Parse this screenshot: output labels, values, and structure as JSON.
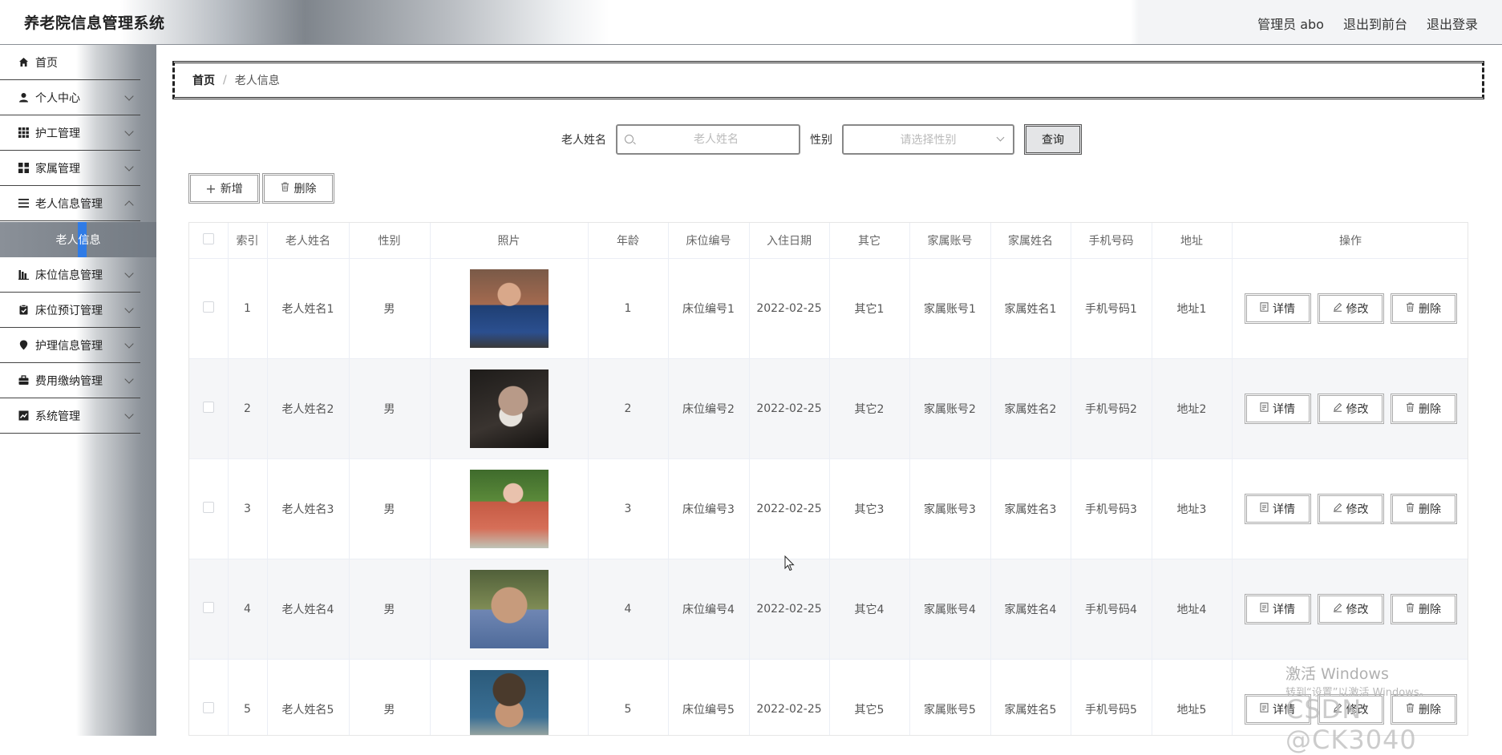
{
  "header": {
    "app_title": "养老院信息管理系统",
    "admin_label": "管理员 abo",
    "to_front_label": "退出到前台",
    "logout_label": "退出登录"
  },
  "sidebar": {
    "items": [
      {
        "label": "首页",
        "icon": "home-icon"
      },
      {
        "label": "个人中心",
        "icon": "user-icon"
      },
      {
        "label": "护工管理",
        "icon": "grid-icon"
      },
      {
        "label": "家属管理",
        "icon": "apps-icon"
      },
      {
        "label": "老人信息管理",
        "icon": "list-icon"
      },
      {
        "label": "床位信息管理",
        "icon": "bed-chart-icon"
      },
      {
        "label": "床位预订管理",
        "icon": "clipboard-icon"
      },
      {
        "label": "护理信息管理",
        "icon": "location-icon"
      },
      {
        "label": "费用缴纳管理",
        "icon": "briefcase-icon"
      },
      {
        "label": "系统管理",
        "icon": "trend-icon"
      }
    ],
    "active_sub": "老人信息"
  },
  "breadcrumb": {
    "home": "首页",
    "separator": "/",
    "current": "老人信息"
  },
  "search": {
    "name_label": "老人姓名",
    "name_placeholder": "老人姓名",
    "gender_label": "性别",
    "gender_placeholder": "请选择性别",
    "query_label": "查询"
  },
  "actions": {
    "add_label": "新增",
    "delete_label": "删除"
  },
  "table": {
    "columns": [
      "索引",
      "老人姓名",
      "性别",
      "照片",
      "年龄",
      "床位编号",
      "入住日期",
      "其它",
      "家属账号",
      "家属姓名",
      "手机号码",
      "地址",
      "操作"
    ],
    "rows": [
      {
        "index": "1",
        "name": "老人姓名1",
        "gender": "男",
        "age": "1",
        "bed": "床位编号1",
        "date": "2022-02-25",
        "other": "其它1",
        "family_account": "家属账号1",
        "family_name": "家属姓名1",
        "phone": "手机号码1",
        "address": "地址1"
      },
      {
        "index": "2",
        "name": "老人姓名2",
        "gender": "男",
        "age": "2",
        "bed": "床位编号2",
        "date": "2022-02-25",
        "other": "其它2",
        "family_account": "家属账号2",
        "family_name": "家属姓名2",
        "phone": "手机号码2",
        "address": "地址2"
      },
      {
        "index": "3",
        "name": "老人姓名3",
        "gender": "男",
        "age": "3",
        "bed": "床位编号3",
        "date": "2022-02-25",
        "other": "其它3",
        "family_account": "家属账号3",
        "family_name": "家属姓名3",
        "phone": "手机号码3",
        "address": "地址3"
      },
      {
        "index": "4",
        "name": "老人姓名4",
        "gender": "男",
        "age": "4",
        "bed": "床位编号4",
        "date": "2022-02-25",
        "other": "其它4",
        "family_account": "家属账号4",
        "family_name": "家属姓名4",
        "phone": "手机号码4",
        "address": "地址4"
      },
      {
        "index": "5",
        "name": "老人姓名5",
        "gender": "男",
        "age": "5",
        "bed": "床位编号5",
        "date": "2022-02-25",
        "other": "其它5",
        "family_account": "家属账号5",
        "family_name": "家属姓名5",
        "phone": "手机号码5",
        "address": "地址5"
      }
    ],
    "row_actions": {
      "detail": "详情",
      "edit": "修改",
      "delete": "删除"
    }
  },
  "watermark": {
    "line1": "激活 Windows",
    "line2": "转到“设置”以激活 Windows。",
    "line3": "CSDN @CK3040"
  },
  "colors": {
    "active_bar": "#2f7be6",
    "alt_row_bg": "#f5f6f8"
  }
}
